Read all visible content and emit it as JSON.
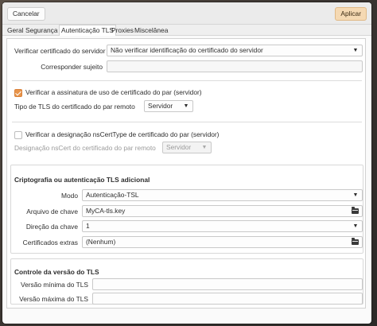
{
  "titlebar": {
    "cancel_label": "Cancelar",
    "apply_label": "Aplicar"
  },
  "tabs": [
    "Geral",
    "Segurança",
    "Autenticação TLS",
    "Proxies",
    "Miscelânea"
  ],
  "active_tab": "Autenticação TLS",
  "verify_cert": {
    "label": "Verificar certificado do servidor",
    "value": "Não verificar identificação do certificado do servidor"
  },
  "match_subject": {
    "label": "Corresponder sujeito",
    "value": ""
  },
  "verify_usage": {
    "label": "Verificar a assinatura de uso de certificado do par (servidor)",
    "checked": true
  },
  "peer_cert_type": {
    "label": "Tipo de TLS do certificado do par remoto",
    "value": "Servidor"
  },
  "verify_nscert": {
    "label": "Verificar a designação nsCertType de certificado do par (servidor)",
    "checked": false
  },
  "nscert_designation": {
    "label": "Designação nsCert do certificado do par remoto",
    "value": "Servidor"
  },
  "crypto_section": {
    "title": "Criptografia ou autenticação TLS adicional",
    "mode": {
      "label": "Modo",
      "value": "Autenticação-TSL"
    },
    "key_file": {
      "label": "Arquivo de chave",
      "value": "MyCA-tls.key"
    },
    "key_direction": {
      "label": "Direção da chave",
      "value": "1"
    },
    "extra_certs": {
      "label": "Certificados extras",
      "value": "(Nenhum)"
    }
  },
  "tls_version_section": {
    "title": "Controle da versão do TLS",
    "min": {
      "label": "Versão mínima do TLS",
      "value": ""
    },
    "max": {
      "label": "Versão máxima do TLS",
      "value": ""
    }
  },
  "icons": {
    "dropdown": "chevron-down-icon",
    "file": "folder-icon",
    "check": "checkmark-icon"
  },
  "colors": {
    "accent": "#e8944a",
    "apply_bg": "#f5d9b3"
  }
}
